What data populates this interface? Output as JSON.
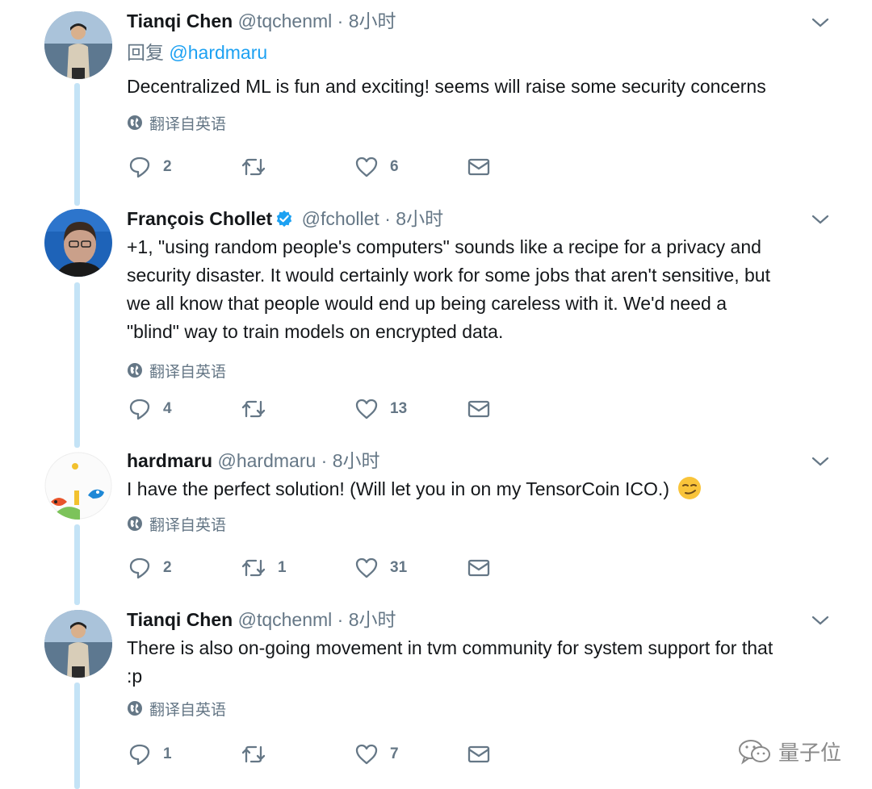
{
  "tweets": [
    {
      "name": "Tianqi Chen",
      "handle": "@tqchenml",
      "dot": "·",
      "time": "8小时",
      "reply_prefix": "回复",
      "reply_to": "@hardmaru",
      "lines": [
        "Decentralized ML is fun and exciting! seems will raise some security concerns"
      ],
      "translate": "翻译自英语",
      "replies": "2",
      "retweets": "",
      "likes": "6"
    },
    {
      "name": "François Chollet",
      "handle": "@fchollet",
      "dot": "·",
      "time": "8小时",
      "verified": true,
      "lines": [
        "+1, \"using random people's computers\" sounds like a recipe for a privacy and",
        "security disaster. It would certainly work for some jobs that aren't sensitive, but",
        "we all know that people would end up being careless with it. We'd need a",
        "\"blind\" way to train models on encrypted data."
      ],
      "translate": "翻译自英语",
      "replies": "4",
      "retweets": "",
      "likes": "13"
    },
    {
      "name": "hardmaru",
      "handle": "@hardmaru",
      "dot": "·",
      "time": "8小时",
      "lines": [
        "I have the perfect solution! (Will let you in on my TensorCoin ICO.)"
      ],
      "emoji": "smirk-emoji",
      "translate": "翻译自英语",
      "replies": "2",
      "retweets": "1",
      "likes": "31"
    },
    {
      "name": "Tianqi Chen",
      "handle": "@tqchenml",
      "dot": "·",
      "time": "8小时",
      "lines": [
        "There is also on-going movement in tvm community for system support for that",
        ":p"
      ],
      "translate": "翻译自英语",
      "replies": "1",
      "retweets": "",
      "likes": "7"
    }
  ],
  "watermark": "量子位",
  "colors": {
    "accent": "#1da1f2",
    "muted": "#657786",
    "thread_line": "#c4e3f6",
    "verified": "#1da1f2"
  }
}
